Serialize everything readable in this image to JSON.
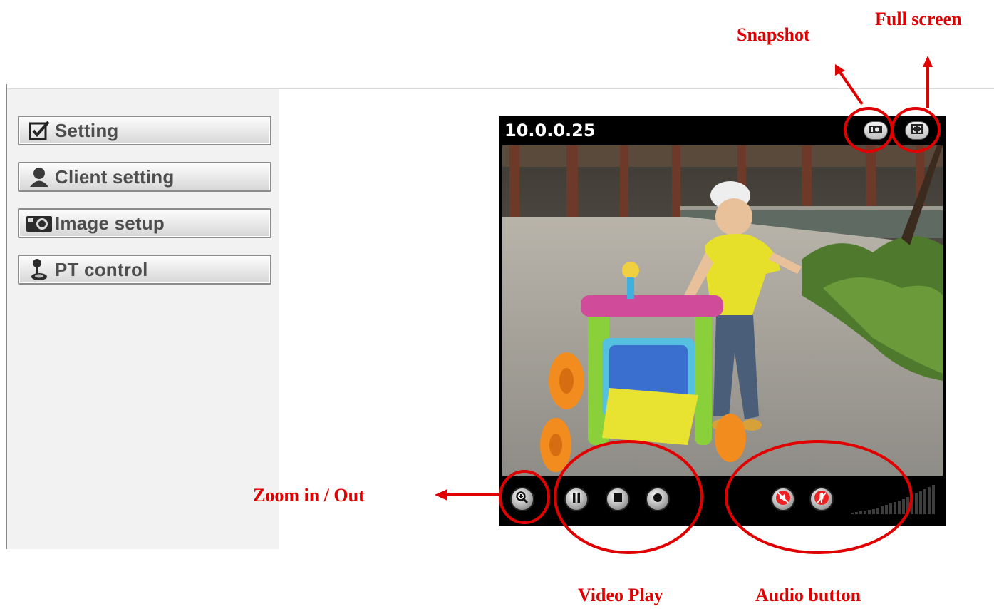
{
  "sidebar": {
    "items": [
      {
        "label": "Setting",
        "icon": "checkbox-icon"
      },
      {
        "label": "Client setting",
        "icon": "user-icon"
      },
      {
        "label": "Image setup",
        "icon": "camera-icon"
      },
      {
        "label": "PT control",
        "icon": "joystick-icon"
      }
    ]
  },
  "viewer": {
    "title": "10.0.0.25",
    "buttons": {
      "snapshot": "snapshot-icon",
      "fullscreen": "fullscreen-icon",
      "zoom": "zoom-in-icon",
      "pause": "pause-icon",
      "stop": "stop-icon",
      "record": "record-icon",
      "speaker_mute": "speaker-mute-icon",
      "mic_mute": "microphone-mute-icon"
    }
  },
  "annotations": {
    "snapshot": "Snapshot",
    "fullscreen": "Full screen",
    "zoom": "Zoom in / Out",
    "video_play": "Video Play",
    "audio_button": "Audio button"
  },
  "colors": {
    "annotation": "#e00000",
    "viewer_bg": "#000000",
    "sidebar_bg": "#f2f2f2"
  }
}
